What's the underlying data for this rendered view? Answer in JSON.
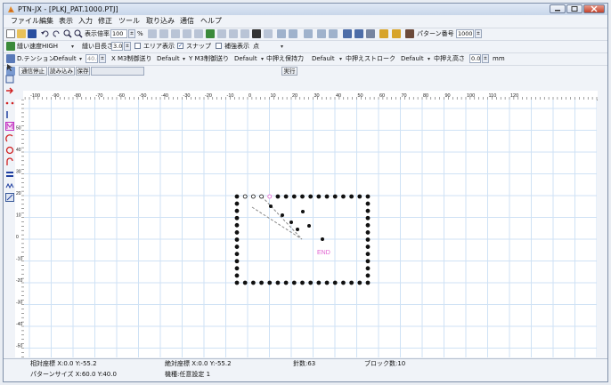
{
  "window": {
    "title": "PTN-JX - [PLKJ_PAT.1000.PTJ]"
  },
  "menu": [
    "ファイル",
    "編集",
    "表示",
    "入力",
    "修正",
    "ツール",
    "取り込み",
    "通信",
    "ヘルプ"
  ],
  "toolbar1": {
    "display_scale_label": "表示倍率",
    "display_scale_value": "100",
    "percent": "%",
    "pattern_no_label": "パターン番号",
    "pattern_no_value": "1000"
  },
  "toolbar2": {
    "sew_speed_label": "縫い速度",
    "sew_speed_value": "HIGH",
    "stitch_length_label": "縫い目長さ",
    "stitch_length_value": "3.0",
    "area_display_label": "エリア表示",
    "area_display_checked": false,
    "snap_label": "スナップ",
    "snap_checked": true,
    "auxiliary_display_label": "補強表示",
    "auxiliary_display_checked": false,
    "point_label": "点"
  },
  "toolbar3": {
    "tension_label": "D.テンション",
    "tension_value": "Default",
    "tension_num": "40.0",
    "x_feed_label": "X M3制御送り",
    "x_feed_value": "Default",
    "y_feed_label": "Y M3制御送り",
    "y_feed_value": "Default",
    "presser_pressure_label": "中押え保持力",
    "presser_pressure_value": "Default",
    "presser_stroke_label": "中押えストローク",
    "presser_stroke_value": "Default",
    "presser_height_label": "中押え高さ",
    "presser_height_value": "0.0",
    "unit": "mm"
  },
  "toolbar4": {
    "comm_stop_label": "通信停止",
    "read_label": "読み込み",
    "save_label": "保存",
    "exec_label": "実行"
  },
  "ruler": {
    "x_ticks": [
      "-120",
      "-110",
      "-100",
      "-90",
      "-80",
      "-70",
      "-60",
      "-50",
      "-40",
      "-30",
      "-20",
      "-10",
      "0",
      "10",
      "20",
      "30",
      "40",
      "50",
      "60",
      "70",
      "80",
      "90",
      "100",
      "110",
      "120"
    ],
    "y_ticks": [
      "50",
      "40",
      "30",
      "20",
      "10",
      "0",
      "-10",
      "-20",
      "-30",
      "-40",
      "-50"
    ]
  },
  "canvas": {
    "end_label": "END"
  },
  "status": {
    "relative_coord": "相対座標 X:0.0 Y:-55.2",
    "absolute_coord": "絶対座標 X:0.0 Y:-55.2",
    "stitch_count": "針数:63",
    "block_count": "ブロック数:10",
    "pattern_size": "パターンサイズ X:60.0 Y:40.0",
    "machine_type": "機種:任意設定 1"
  },
  "colors": {
    "grid": "#cfe2f5",
    "accent": "#e060d0",
    "title_bg": "#d3deee"
  }
}
